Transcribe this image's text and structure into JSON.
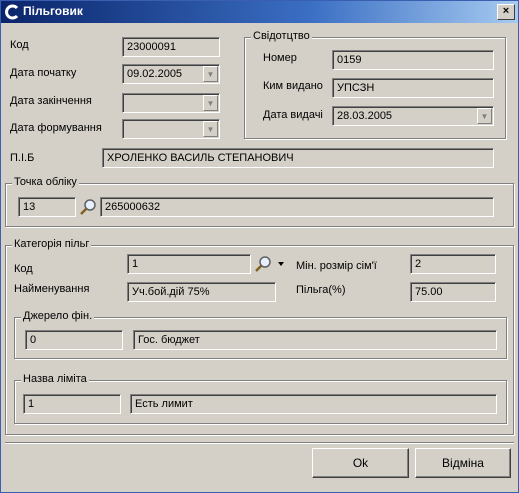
{
  "window": {
    "title": "Пільговик",
    "close_glyph": "×"
  },
  "main": {
    "kod_label": "Код",
    "kod_value": "23000091",
    "start_label": "Дата початку",
    "start_value": "09.02.2005",
    "end_label": "Дата закінчення",
    "end_value": "",
    "form_label": "Дата формування",
    "form_value": "",
    "pib_label": "П.І.Б",
    "pib_value": "ХРОЛЕНКО ВАСИЛЬ СТЕПАНОВИЧ"
  },
  "certificate": {
    "caption": "Свідотцтво",
    "number_label": "Номер",
    "number_value": "0159",
    "issuer_label": "Ким видано",
    "issuer_value": "УПСЗН",
    "date_label": "Дата видачі",
    "date_value": "28.03.2005"
  },
  "account": {
    "caption": "Точка обліку",
    "code": "13",
    "number": "265000632"
  },
  "benefit": {
    "caption": "Категорія пільг",
    "kod_label": "Код",
    "kod_value": "1",
    "name_label": "Найменування",
    "name_value": "Уч.бой.дій 75%",
    "family_label": "Мін. розмір сім'ї",
    "family_value": "2",
    "percent_label": "Пільга(%)",
    "percent_value": "75.00",
    "funding": {
      "caption": "Джерело фін.",
      "code": "0",
      "name": "Гос. бюджет"
    },
    "limit": {
      "caption": "Назва ліміта",
      "code": "1",
      "name": "Есть лимит"
    }
  },
  "buttons": {
    "ok": "Ok",
    "cancel": "Відміна"
  },
  "icons": {
    "search": "magnifier-icon",
    "dropdown": "dropdown-arrow-icon"
  }
}
